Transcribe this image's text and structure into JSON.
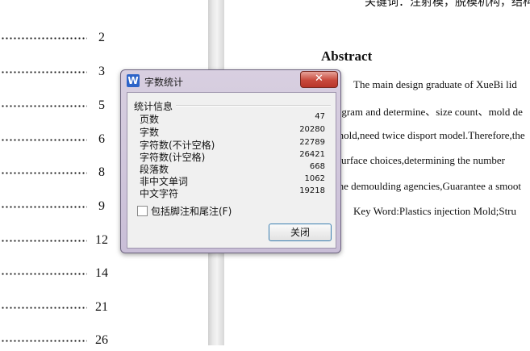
{
  "toc": {
    "page_numbers": [
      "2",
      "3",
      "5",
      "6",
      "8",
      "9",
      "12",
      "14",
      "21",
      "26"
    ]
  },
  "document": {
    "keywords_top": "关键词：注射模，脱模机构，结构",
    "abstract_heading": "Abstract",
    "abstract_lines": [
      "The main design graduate of XueBi lid",
      "program and determine、size count、mold de",
      "mold,need twice disport model.Therefore,the",
      "surface choices,determining the number",
      "the demoulding agencies,Guarantee a smoot",
      "Key Word:Plastics injection Mold;Stru"
    ]
  },
  "dialog": {
    "icon_letter": "W",
    "title": "字数统计",
    "close_glyph": "✕",
    "group_label": "统计信息",
    "stats": [
      {
        "label": "页数",
        "value": "47"
      },
      {
        "label": "字数",
        "value": "20280"
      },
      {
        "label": "字符数(不计空格)",
        "value": "22789"
      },
      {
        "label": "字符数(计空格)",
        "value": "26421"
      },
      {
        "label": "段落数",
        "value": "668"
      },
      {
        "label": "非中文单词",
        "value": "1062"
      },
      {
        "label": "中文字符",
        "value": "19218"
      }
    ],
    "checkbox_label": "包括脚注和尾注(F)",
    "close_button": "关闭"
  }
}
